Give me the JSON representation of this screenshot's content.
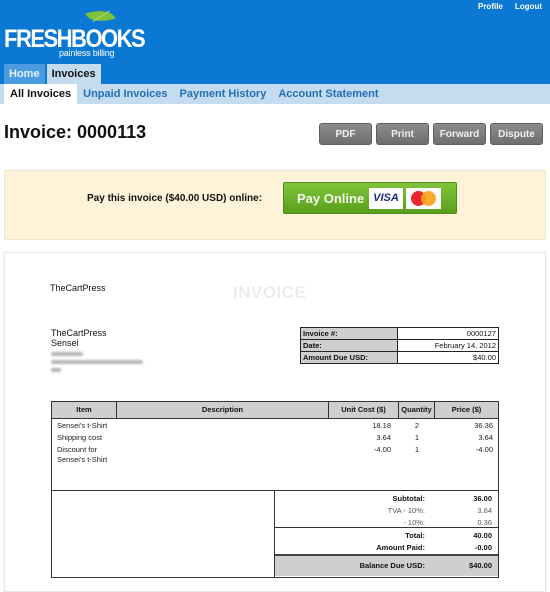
{
  "header": {
    "logo_text": "FRESHBOOKS",
    "logo_tagline": "painless billing",
    "top_links": [
      "Profile",
      "Logout"
    ],
    "main_tabs": [
      {
        "label": "Home",
        "active": false
      },
      {
        "label": "Invoices",
        "active": true
      }
    ]
  },
  "subnav": {
    "items": [
      {
        "label": "All Invoices",
        "active": true
      },
      {
        "label": "Unpaid Invoices",
        "active": false
      },
      {
        "label": "Payment History",
        "active": false
      },
      {
        "label": "Account Statement",
        "active": false
      }
    ]
  },
  "page": {
    "title": "Invoice: 0000113",
    "actions": [
      "PDF",
      "Print",
      "Forward",
      "Dispute"
    ]
  },
  "pay_banner": {
    "label": "Pay this invoice ($40.00 USD) online:",
    "button_label": "Pay Online",
    "cards": [
      "VISA",
      "MasterCard"
    ],
    "colors": {
      "button": "#6bb22a",
      "background": "#fcf3d8"
    }
  },
  "invoice": {
    "company": "TheCartPress",
    "watermark": "INVOICE",
    "client": {
      "line1": "TheCartPress",
      "line2": "Sensei"
    },
    "meta": [
      {
        "label": "Invoice #:",
        "value": "0000127"
      },
      {
        "label": "Date:",
        "value": "February 14, 2012"
      },
      {
        "label": "Amount Due USD:",
        "value": "$40.00"
      }
    ],
    "columns": [
      "Item",
      "Description",
      "Unit Cost ($)",
      "Quantity",
      "Price ($)"
    ],
    "lines": [
      {
        "item": "Sensei's t-Shirt",
        "description": "",
        "unit_cost": "18.18",
        "quantity": "2",
        "price": "36.36"
      },
      {
        "item": "Shipping cost",
        "description": "",
        "unit_cost": "3.64",
        "quantity": "1",
        "price": "3.64"
      },
      {
        "item": "Discount for Sensei's t-Shirt",
        "description": "",
        "unit_cost": "-4.00",
        "quantity": "1",
        "price": "-4.00"
      }
    ],
    "totals": {
      "subtotal_label": "Subtotal:",
      "subtotal": "36.00",
      "tax1_label": "TVA - 10%:",
      "tax1": "3.64",
      "tax2_label": "- 10%:",
      "tax2": "0.36",
      "total_label": "Total:",
      "total": "40.00",
      "paid_label": "Amount Paid:",
      "paid": "-0.00",
      "balance_label": "Balance Due USD:",
      "balance": "$40.00"
    }
  }
}
